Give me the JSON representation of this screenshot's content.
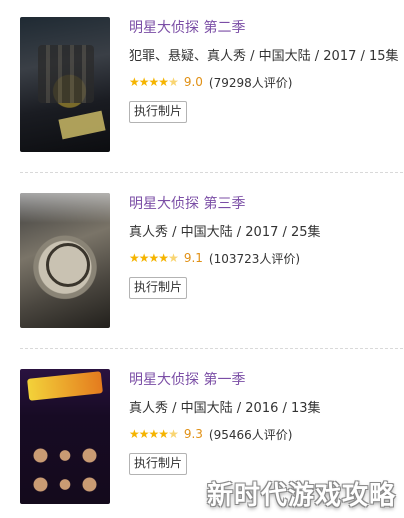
{
  "items": [
    {
      "title": "明星大侦探 第二季",
      "meta": "犯罪、悬疑、真人秀 / 中国大陆 / 2017 / 15集",
      "stars": 4.5,
      "score": "9.0",
      "count": "(79298人评价)",
      "button": "执行制片"
    },
    {
      "title": "明星大侦探 第三季",
      "meta": "真人秀 / 中国大陆 / 2017 / 25集",
      "stars": 4.5,
      "score": "9.1",
      "count": "(103723人评价)",
      "button": "执行制片"
    },
    {
      "title": "明星大侦探 第一季",
      "meta": "真人秀 / 中国大陆 / 2016 / 13集",
      "stars": 4.5,
      "score": "9.3",
      "count": "(95466人评价)",
      "button": "执行制片"
    }
  ],
  "watermark": "新时代游戏攻略",
  "colors": {
    "title": "#7b4ea6",
    "star": "#f5b400",
    "score": "#e09015"
  }
}
